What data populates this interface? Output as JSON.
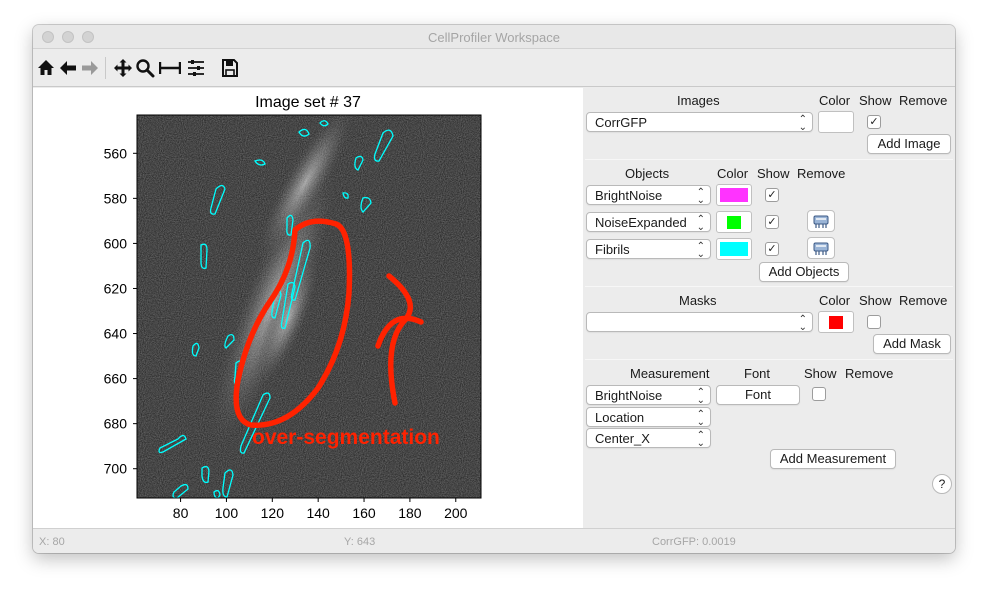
{
  "window": {
    "title": "CellProfiler Workspace"
  },
  "toolbar": {
    "icons": [
      "home-icon",
      "back-icon",
      "forward-icon",
      "pan-icon",
      "zoom-icon",
      "subplot-adjust-icon",
      "configure-icon",
      "save-icon"
    ]
  },
  "plot": {
    "title": "Image set # 37",
    "annotation": "over-segmentation",
    "annotation_color": "#ff2200",
    "outline_color": "#00ffff"
  },
  "chart_data": {
    "type": "heatmap",
    "title": "Image set # 37",
    "xticks": [
      80,
      100,
      120,
      140,
      160,
      180,
      200
    ],
    "yticks": [
      560,
      580,
      600,
      620,
      640,
      660,
      680,
      700
    ],
    "xlim": [
      61,
      211
    ],
    "ylim": [
      713,
      543
    ]
  },
  "panel": {
    "images": {
      "header": "Images",
      "color_header": "Color",
      "show_header": "Show",
      "remove_header": "Remove",
      "rows": [
        {
          "name": "CorrGFP",
          "color": "#ffffff",
          "show": true
        }
      ],
      "add_button": "Add Image"
    },
    "objects": {
      "header": "Objects",
      "color_header": "Color",
      "show_header": "Show",
      "remove_header": "Remove",
      "rows": [
        {
          "name": "BrightNoise",
          "color": "#ff33ff",
          "show": true
        },
        {
          "name": "NoiseExpanded",
          "color": "#00ff00",
          "show": true
        },
        {
          "name": "Fibrils",
          "color": "#00ffff",
          "show": true
        }
      ],
      "add_button": "Add Objects"
    },
    "masks": {
      "header": "Masks",
      "color_header": "Color",
      "show_header": "Show",
      "remove_header": "Remove",
      "rows": [
        {
          "name": "",
          "color": "#ff0000",
          "show": false
        }
      ],
      "add_button": "Add Mask"
    },
    "measurement": {
      "header": "Measurement",
      "font_header": "Font",
      "show_header": "Show",
      "remove_header": "Remove",
      "object": "BrightNoise",
      "category": "Location",
      "feature": "Center_X",
      "font_button": "Font",
      "show": false,
      "add_button": "Add Measurement"
    },
    "help": "?"
  },
  "status": {
    "x": "X: 80",
    "y": "Y: 643",
    "value": "CorrGFP: 0.0019"
  }
}
